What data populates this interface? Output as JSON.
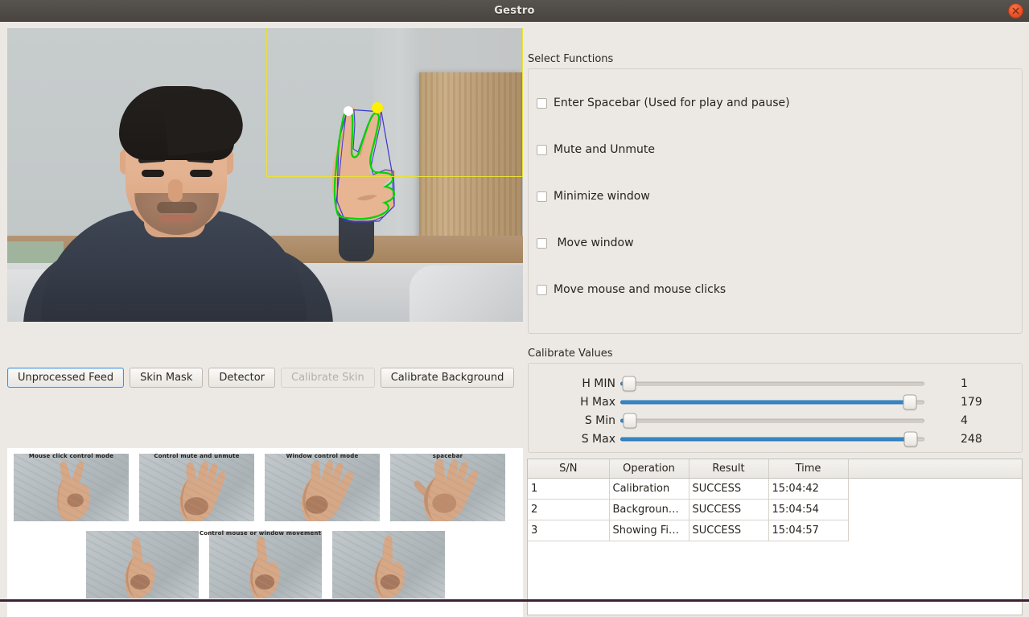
{
  "window": {
    "title": "Gestro",
    "close_icon": "close-icon"
  },
  "video": {
    "overlay_roi_color": "#e9e03a",
    "contour_color": "#00d000",
    "hull_color": "#3a3ad0",
    "fingertip_colors": [
      "#ffffff",
      "#ffee00"
    ]
  },
  "view_buttons": [
    {
      "label": "Unprocessed Feed",
      "state": "focused"
    },
    {
      "label": "Skin Mask",
      "state": "normal"
    },
    {
      "label": "Detector",
      "state": "normal"
    },
    {
      "label": "Calibrate Skin",
      "state": "disabled"
    },
    {
      "label": "Calibrate Background",
      "state": "normal"
    }
  ],
  "gesture_guide": {
    "row1": [
      {
        "caption": "Mouse click control mode",
        "gesture": "two-fingers"
      },
      {
        "caption": "Control mute and unmute",
        "gesture": "four-fingers"
      },
      {
        "caption": "Window control mode",
        "gesture": "four-fingers-spread"
      },
      {
        "caption": "spacebar",
        "gesture": "open-palm"
      }
    ],
    "row2_caption": "Control mouse or window movement",
    "row2": [
      {
        "gesture": "index-finger-1"
      },
      {
        "gesture": "index-finger-2"
      },
      {
        "gesture": "index-finger-3"
      }
    ]
  },
  "functions": {
    "group_label": "Select Functions",
    "items": [
      {
        "label": "Enter Spacebar (Used for play and pause)",
        "checked": false
      },
      {
        "label": "Mute and Unmute",
        "checked": false
      },
      {
        "label": "Minimize window",
        "checked": false
      },
      {
        "label": " Move window",
        "checked": false
      },
      {
        "label": "Move mouse and mouse clicks",
        "checked": false
      }
    ]
  },
  "calibrate": {
    "group_label": "Calibrate Values",
    "sliders": [
      {
        "label": "H MIN",
        "value": "1",
        "percent": 1
      },
      {
        "label": "H Max",
        "value": "179",
        "percent": 95
      },
      {
        "label": "S Min",
        "value": "4",
        "percent": 1.5
      },
      {
        "label": "S Max",
        "value": "248",
        "percent": 95
      }
    ]
  },
  "log_table": {
    "columns": [
      "S/N",
      "Operation",
      "Result",
      "Time"
    ],
    "rows": [
      {
        "sn": "1",
        "operation": "Calibration",
        "result": "SUCCESS",
        "time": "15:04:42"
      },
      {
        "sn": "2",
        "operation": "Backgroun…",
        "result": "SUCCESS",
        "time": "15:04:54"
      },
      {
        "sn": "3",
        "operation": "Showing Fi…",
        "result": "SUCCESS",
        "time": "15:04:57"
      }
    ]
  }
}
